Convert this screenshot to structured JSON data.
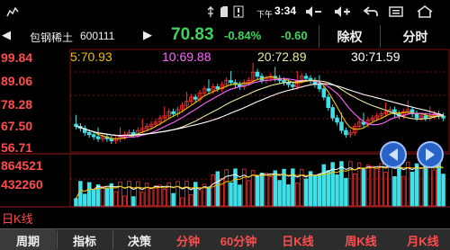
{
  "status_bar": {
    "time_prefix": "下午",
    "time": "3:34",
    "icons": [
      "notification-icon",
      "usb-icon",
      "sd-card-icon",
      "alert-icon",
      "volume-down-icon",
      "volume-up-icon",
      "back-icon",
      "menu-icon",
      "home-icon"
    ]
  },
  "header": {
    "stock_name": "包钢稀土",
    "stock_code": "600111",
    "price": "70.83",
    "change_pct": "-0.84%",
    "change_amt": "-0.60",
    "btn_restore": "除权",
    "btn_timeshare": "分时"
  },
  "moving_averages": {
    "ma5": {
      "label": "5:",
      "value": "70.93",
      "color": "#f0c000"
    },
    "ma10": {
      "label": "10:",
      "value": "69.88",
      "color": "#ff66ff"
    },
    "ma20": {
      "label": "20:",
      "value": "72.89",
      "color": "#e8e8a0"
    },
    "ma30": {
      "label": "30:",
      "value": "71.59",
      "color": "#ffffff"
    }
  },
  "chart_data": {
    "type": "candlestick",
    "price_ticks": [
      "99.84",
      "89.06",
      "78.28",
      "67.50",
      "56.71"
    ],
    "volume_ticks": [
      "864521",
      "432260"
    ],
    "ylim": [
      56.71,
      99.84
    ],
    "period_label": "日K线",
    "up_color": "#ff3030",
    "down_color": "#40e0e8"
  },
  "bottom_tabs": [
    {
      "label": "周期",
      "color": "white"
    },
    {
      "label": "指标",
      "color": "white"
    },
    {
      "label": "决策",
      "color": "white"
    },
    {
      "label": "分钟",
      "color": "red"
    },
    {
      "label": "60分钟",
      "color": "red"
    },
    {
      "label": "日K线",
      "color": "red"
    },
    {
      "label": "周K线",
      "color": "red"
    },
    {
      "label": "月K线",
      "color": "red"
    }
  ]
}
